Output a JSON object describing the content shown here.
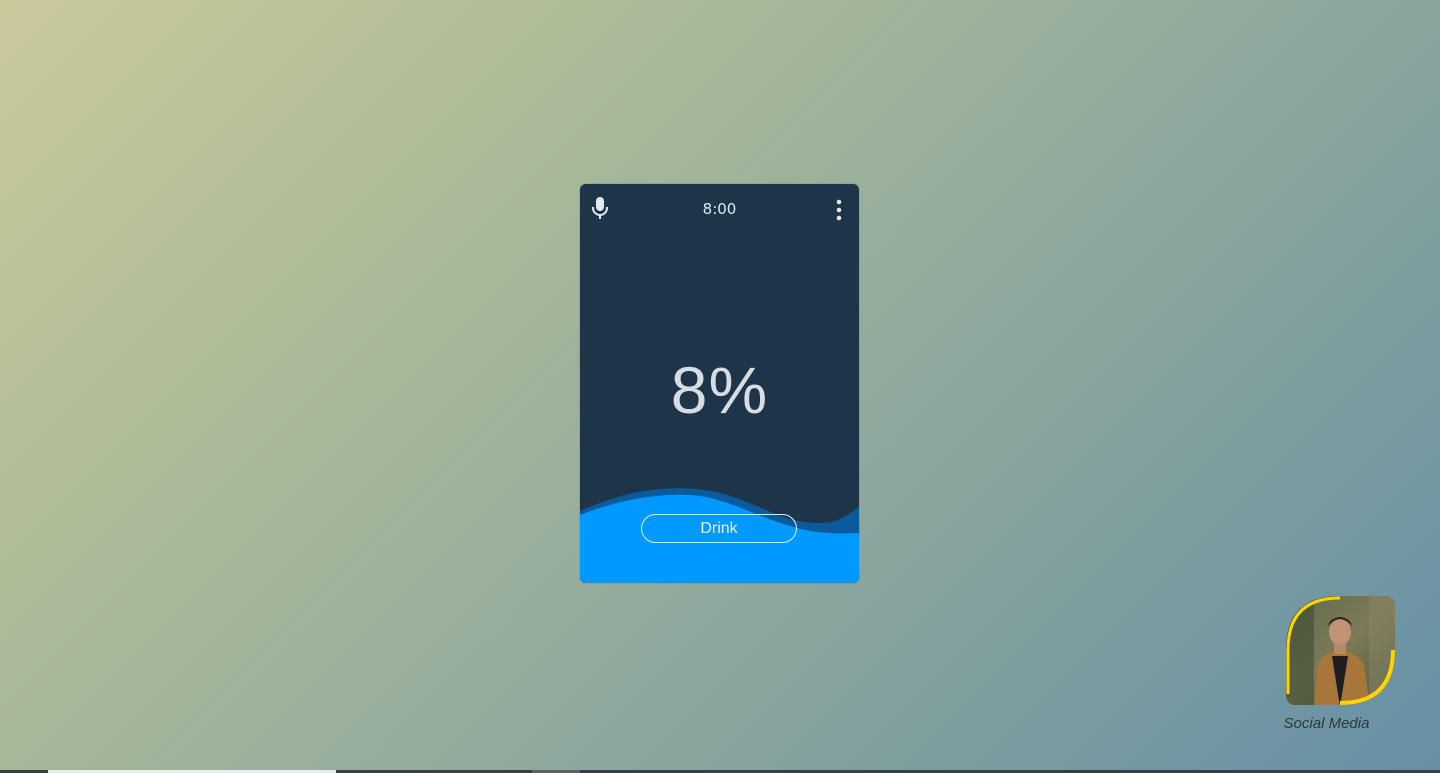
{
  "widget": {
    "time": "8:00",
    "percent_text": "8%",
    "percent_value": 8,
    "drink_label": "Drink",
    "icons": {
      "left": "microphone-icon",
      "right": "more-vertical-icon"
    },
    "colors": {
      "card_bg": "#1e3449",
      "wave_back": "#0a5a9c",
      "wave_front": "#0099ff",
      "text": "#d7dde3"
    }
  },
  "profile": {
    "caption": "Social Media",
    "ring_color": "#ffd400"
  }
}
